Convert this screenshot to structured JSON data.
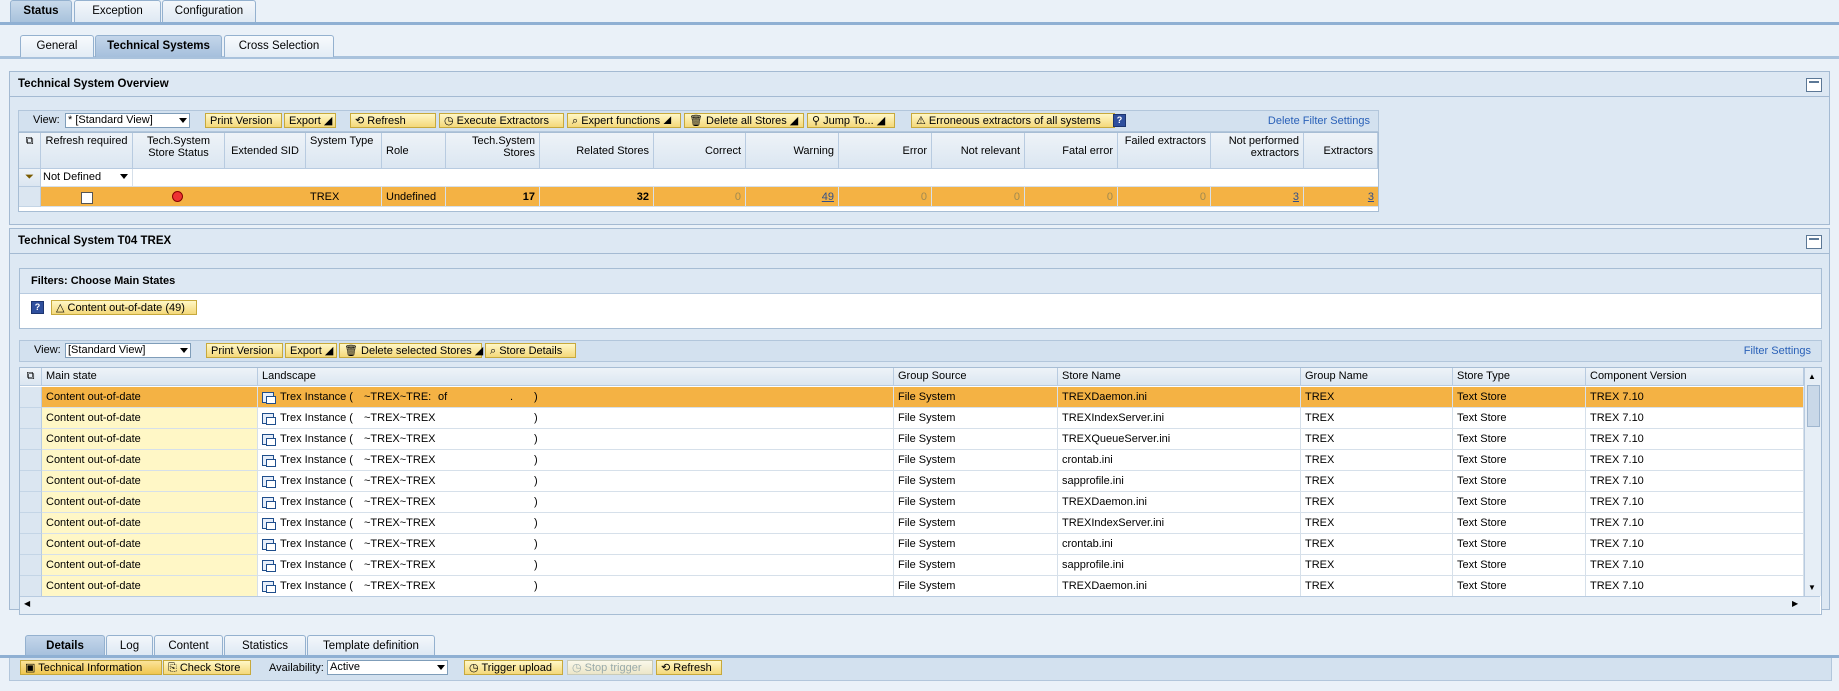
{
  "top_tabs": [
    "Status",
    "Exception",
    "Configuration"
  ],
  "sub_tabs": [
    "General",
    "Technical Systems",
    "Cross Selection"
  ],
  "overview": {
    "title": "Technical System Overview",
    "view_label": "View:",
    "view_value": "* [Standard View]",
    "buttons": {
      "print": "Print Version",
      "export": "Export",
      "refresh": "Refresh",
      "execute": "Execute Extractors",
      "expert": "Expert functions",
      "delete_all": "Delete all Stores",
      "jump": "Jump To...",
      "erroneous": "Erroneous extractors of all systems"
    },
    "delete_filter": "Delete Filter Settings",
    "filter_value": "Not Defined",
    "headers": [
      "Refresh required",
      "Tech.System Store Status",
      "Extended SID",
      "System Type",
      "Role",
      "Tech.System Stores",
      "Related Stores",
      "Correct",
      "Warning",
      "Error",
      "Not relevant",
      "Fatal error",
      "Failed extractors",
      "Not performed extractors",
      "Extractors"
    ],
    "row": {
      "system_type": "TREX",
      "role": "Undefined",
      "tech_stores": "17",
      "related_stores": "32",
      "correct": "0",
      "warning": "49",
      "error": "0",
      "not_relevant": "0",
      "fatal": "0",
      "failed": "0",
      "not_performed": "3",
      "extractors": "3"
    }
  },
  "system_panel": {
    "title": "Technical System T04 TREX",
    "filters_title": "Filters: Choose Main States",
    "filter_button": "Content out-of-date (49)"
  },
  "stores": {
    "view_label": "View:",
    "view_value": "[Standard View]",
    "buttons": {
      "print": "Print Version",
      "export": "Export",
      "delete_selected": "Delete selected Stores",
      "store_details": "Store Details"
    },
    "filter_settings": "Filter Settings",
    "headers": [
      "Main state",
      "Landscape",
      "Group Source",
      "Store Name",
      "Group Name",
      "Store Type",
      "Component Version"
    ],
    "rows": [
      {
        "state": "Content out-of-date",
        "land_a": "Trex Instance (",
        "land_b": "~TREX~TRE:",
        "land_c": "of",
        "land_d": ".",
        "land_e": ")",
        "source": "File System",
        "store": "TREXDaemon.ini",
        "group": "TREX",
        "type": "Text Store",
        "version": "TREX 7.10"
      },
      {
        "state": "Content out-of-date",
        "land_a": "Trex Instance (",
        "land_b": "~TREX~TREX",
        "land_c": "",
        "land_d": "",
        "land_e": ")",
        "source": "File System",
        "store": "TREXIndexServer.ini",
        "group": "TREX",
        "type": "Text Store",
        "version": "TREX 7.10"
      },
      {
        "state": "Content out-of-date",
        "land_a": "Trex Instance (",
        "land_b": "~TREX~TREX",
        "land_c": "",
        "land_d": "",
        "land_e": ")",
        "source": "File System",
        "store": "TREXQueueServer.ini",
        "group": "TREX",
        "type": "Text Store",
        "version": "TREX 7.10"
      },
      {
        "state": "Content out-of-date",
        "land_a": "Trex Instance (",
        "land_b": "~TREX~TREX",
        "land_c": "",
        "land_d": "",
        "land_e": ")",
        "source": "File System",
        "store": "crontab.ini",
        "group": "TREX",
        "type": "Text Store",
        "version": "TREX 7.10"
      },
      {
        "state": "Content out-of-date",
        "land_a": "Trex Instance (",
        "land_b": "~TREX~TREX",
        "land_c": "",
        "land_d": "",
        "land_e": ")",
        "source": "File System",
        "store": "sapprofile.ini",
        "group": "TREX",
        "type": "Text Store",
        "version": "TREX 7.10"
      },
      {
        "state": "Content out-of-date",
        "land_a": "Trex Instance (",
        "land_b": "~TREX~TREX",
        "land_c": "",
        "land_d": "",
        "land_e": ")",
        "source": "File System",
        "store": "TREXDaemon.ini",
        "group": "TREX",
        "type": "Text Store",
        "version": "TREX 7.10"
      },
      {
        "state": "Content out-of-date",
        "land_a": "Trex Instance (",
        "land_b": "~TREX~TREX",
        "land_c": "",
        "land_d": "",
        "land_e": ")",
        "source": "File System",
        "store": "TREXIndexServer.ini",
        "group": "TREX",
        "type": "Text Store",
        "version": "TREX 7.10"
      },
      {
        "state": "Content out-of-date",
        "land_a": "Trex Instance (",
        "land_b": "~TREX~TREX",
        "land_c": "",
        "land_d": "",
        "land_e": ")",
        "source": "File System",
        "store": "crontab.ini",
        "group": "TREX",
        "type": "Text Store",
        "version": "TREX 7.10"
      },
      {
        "state": "Content out-of-date",
        "land_a": "Trex Instance (",
        "land_b": "~TREX~TREX",
        "land_c": "",
        "land_d": "",
        "land_e": ")",
        "source": "File System",
        "store": "sapprofile.ini",
        "group": "TREX",
        "type": "Text Store",
        "version": "TREX 7.10"
      },
      {
        "state": "Content out-of-date",
        "land_a": "Trex Instance (",
        "land_b": "~TREX~TREX",
        "land_c": "",
        "land_d": "",
        "land_e": ")",
        "source": "File System",
        "store": "TREXDaemon.ini",
        "group": "TREX",
        "type": "Text Store",
        "version": "TREX 7.10"
      }
    ]
  },
  "detail_tabs": [
    "Details",
    "Log",
    "Content",
    "Statistics",
    "Template definition"
  ],
  "detail_toolbar": {
    "tech_info": "Technical Information",
    "check_store": "Check Store",
    "availability_label": "Availability:",
    "availability_value": "Active",
    "trigger_upload": "Trigger upload",
    "stop_trigger": "Stop trigger",
    "refresh": "Refresh"
  },
  "colors": {
    "accent": "#f4b244",
    "highlight": "#fff7c6",
    "header": "#dde8f3"
  }
}
